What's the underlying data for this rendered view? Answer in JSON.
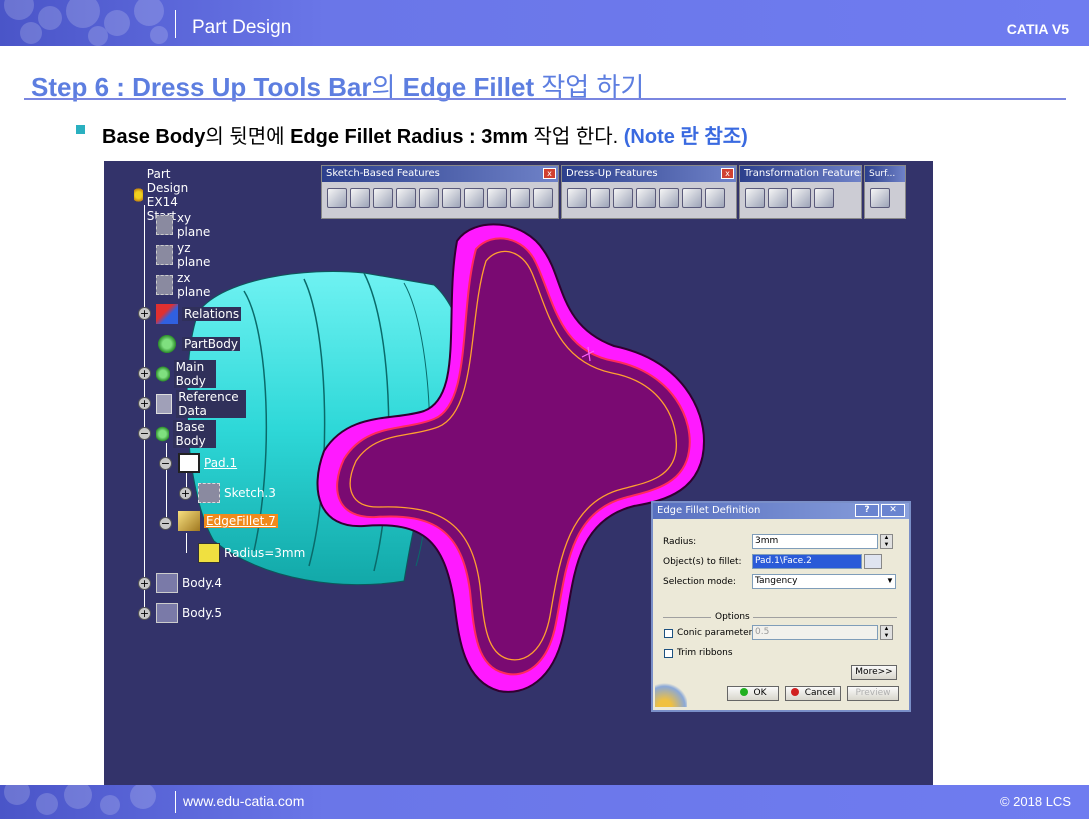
{
  "header": {
    "title": "Part Design",
    "brand": "CATIA V5"
  },
  "footer": {
    "url": "www.edu-catia.com",
    "copyright": "© 2018 LCS"
  },
  "step": {
    "title_en": "Step 6 : Dress Up Tools Bar",
    "title_ko1": "의 ",
    "title_en2": "Edge Fillet",
    "title_ko2": " 작업 하기"
  },
  "instruction": {
    "p1": "Base Body",
    "p2": "의 뒷면에 ",
    "p3": "Edge Fillet Radius : 3mm",
    "p4": " 작업 한다. ",
    "note": "(Note 란 참조)"
  },
  "tree": {
    "root": "Part Design EX14 Start",
    "items": [
      "xy plane",
      "yz plane",
      "zx plane",
      "Relations",
      "PartBody",
      "Main Body",
      "Reference Data",
      "Base Body",
      "Pad.1",
      "Sketch.3",
      "EdgeFillet.7",
      "Radius=3mm",
      "Body.4",
      "Body.5"
    ]
  },
  "toolbars": [
    {
      "title": "Sketch-Based Features"
    },
    {
      "title": "Dress-Up Features"
    },
    {
      "title": "Transformation Features"
    },
    {
      "title": "Surf..."
    }
  ],
  "dialog": {
    "title": "Edge Fillet Definition",
    "help": "?",
    "close": "✕",
    "radius_label": "Radius:",
    "radius_value": "3mm",
    "objects_label": "Object(s) to fillet:",
    "objects_value": "Pad.1\\Face.2",
    "mode_label": "Selection mode:",
    "mode_value": "Tangency",
    "options_label": "Options",
    "conic_label": "Conic parameter:",
    "conic_value": "0.5",
    "trim_label": "Trim ribbons",
    "more_label": "More>>",
    "ok_label": "OK",
    "cancel_label": "Cancel",
    "preview_label": "Preview"
  },
  "colors": {
    "accent": "#5d7ee0",
    "viewport": "#33336a",
    "part_face": "#7a0a72",
    "part_edge": "#ff1aff",
    "cylinder": "#2ee0e0",
    "selected": "#f08a1c"
  }
}
